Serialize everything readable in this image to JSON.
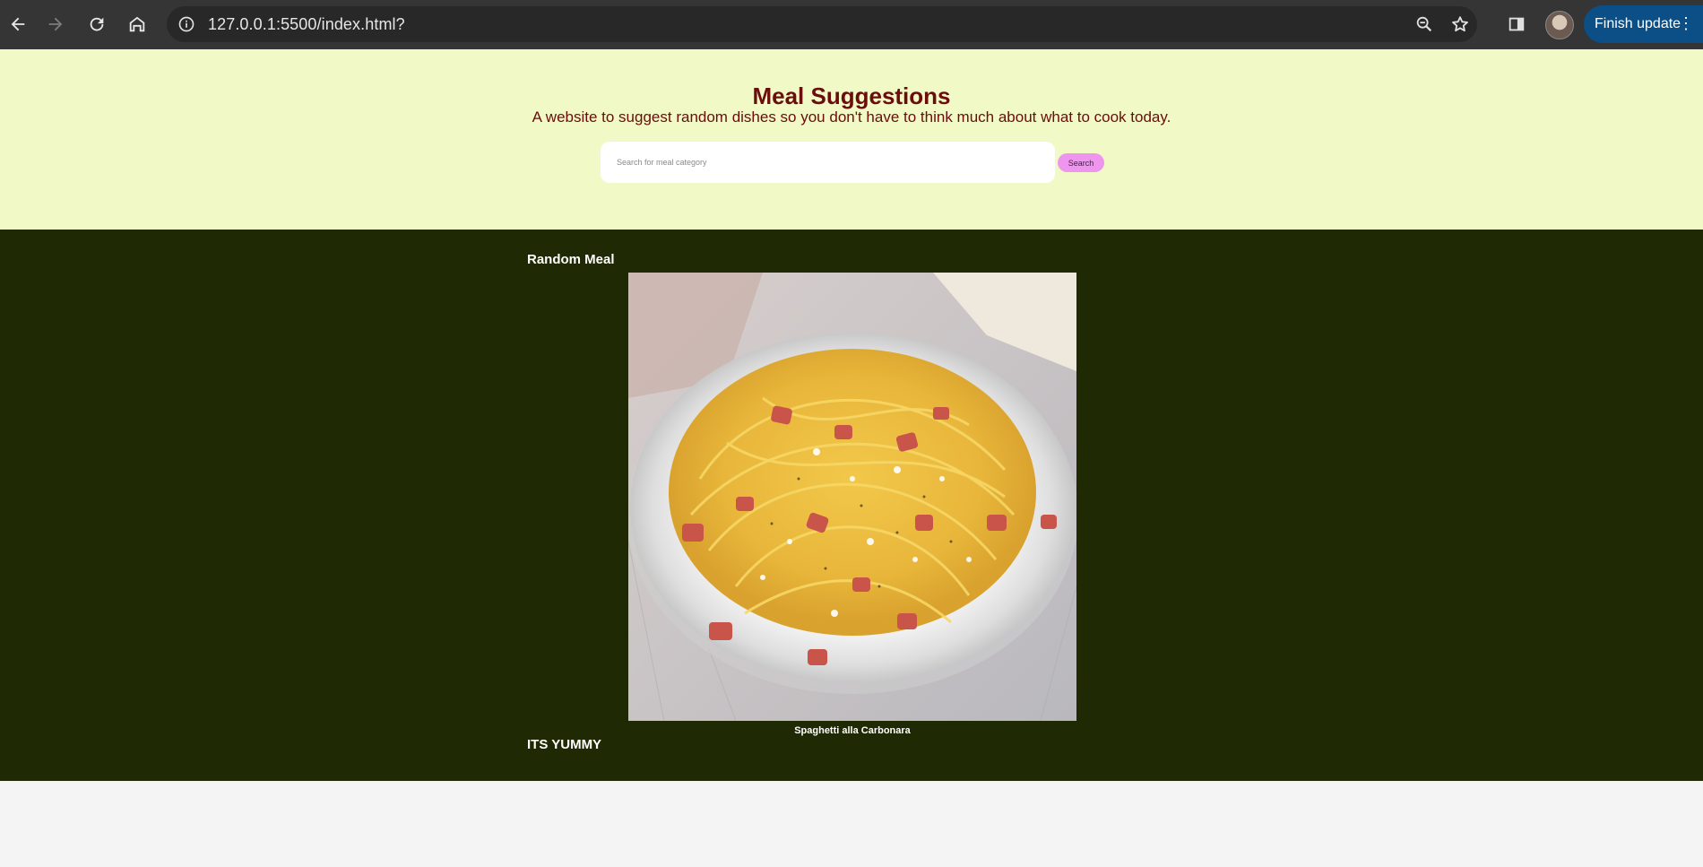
{
  "browser": {
    "url": "127.0.0.1:5500/index.html?",
    "update_label": "Finish update",
    "icons": [
      "back-arrow-icon",
      "forward-arrow-icon",
      "reload-icon",
      "home-icon",
      "info-icon",
      "zoom-icon",
      "star-icon",
      "side-panel-icon",
      "profile-avatar",
      "more-vert-icon"
    ]
  },
  "header": {
    "title": "Meal Suggestions",
    "subtitle": "A website to suggest random dishes so you don't have to think much about what to cook today.",
    "search_placeholder": "Search for meal category",
    "search_value": "",
    "search_button": "Search"
  },
  "main": {
    "section_title": "Random Meal",
    "meal_name": "Spaghetti alla Carbonara",
    "footer_text": "ITS YUMMY"
  },
  "colors": {
    "header_bg": "#f1f9c6",
    "title_color": "#6b0d0d",
    "main_bg": "#1f2a04",
    "search_button_bg": "#ee96ee",
    "update_button_bg": "#0b4f86"
  }
}
